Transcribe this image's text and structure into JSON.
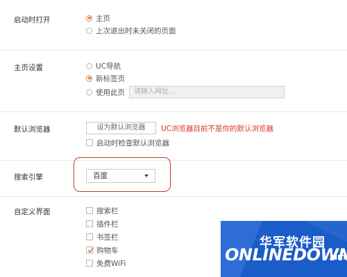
{
  "startup": {
    "label": "启动时打开",
    "options": [
      "主页",
      "上次退出时未关闭的页面"
    ],
    "selected": 0
  },
  "homepage": {
    "label": "主页设置",
    "options": [
      "UC导航",
      "新标签页",
      "使用此页"
    ],
    "selected": 1,
    "url_placeholder": "请输入网址..."
  },
  "default_browser": {
    "label": "默认浏览器",
    "button_label": "设为默认浏览器",
    "warning": "UC浏览器目前不是你的默认浏览器",
    "check_on_start": "启动时检查默认浏览器",
    "check_on_start_checked": false
  },
  "search_engine": {
    "label": "搜索引擎",
    "selected": "百度"
  },
  "custom_ui": {
    "label": "自定义界面",
    "items": [
      {
        "label": "搜索栏",
        "checked": false
      },
      {
        "label": "插件栏",
        "checked": false
      },
      {
        "label": "书签栏",
        "checked": false
      },
      {
        "label": "购物车",
        "checked": true
      },
      {
        "label": "免费WiFi",
        "checked": false
      }
    ]
  },
  "watermark": {
    "cn": "华军软件园",
    "en": "ONLINEDOWN",
    "suffix": ".NET"
  },
  "colors": {
    "accent": "#e5783c",
    "warning": "#d33b2c",
    "highlight": "#c0392b",
    "watermark_blue": "#1a5cc8"
  }
}
